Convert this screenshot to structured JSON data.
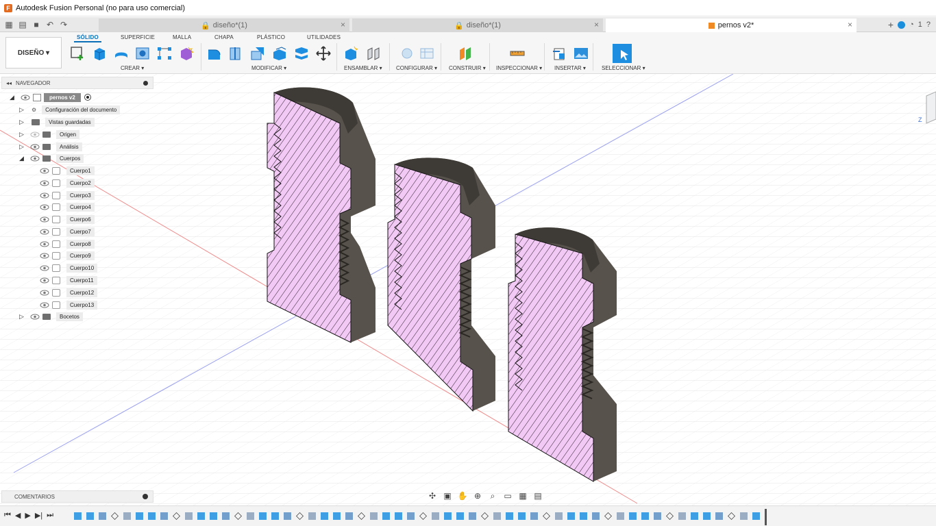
{
  "app": {
    "title": "Autodesk Fusion Personal (no para uso comercial)"
  },
  "tabs": [
    {
      "label": "diseño*(1)",
      "locked": true
    },
    {
      "label": "diseño*(1)",
      "locked": true
    },
    {
      "label": "pernos v2*",
      "active": true
    }
  ],
  "tabbar": {
    "notifications": "1"
  },
  "workspace": {
    "label": "DISEÑO ▾"
  },
  "ribbon_tabs": [
    "SÓLIDO",
    "SUPERFICIE",
    "MALLA",
    "CHAPA",
    "PLÁSTICO",
    "UTILIDADES"
  ],
  "ribbon_groups": [
    "CREAR ▾",
    "MODIFICAR ▾",
    "ENSAMBLAR ▾",
    "CONFIGURAR ▾",
    "CONSTRUIR ▾",
    "INSPECCIONAR ▾",
    "INSERTAR ▾",
    "SELECCIONAR ▾"
  ],
  "browser": {
    "header": "NAVEGADOR",
    "root": "pernos v2",
    "items": [
      "Configuración del documento",
      "Vistas guardadas",
      "Origen",
      "Análisis",
      "Cuerpos"
    ],
    "bodies": [
      "Cuerpo1",
      "Cuerpo2",
      "Cuerpo3",
      "Cuerpo4",
      "Cuerpo6",
      "Cuerpo7",
      "Cuerpo8",
      "Cuerpo9",
      "Cuerpo10",
      "Cuerpo11",
      "Cuerpo12",
      "Cuerpo13"
    ],
    "sketches": "Bocetos"
  },
  "comments": {
    "label": "COMENTARIOS"
  },
  "colors": {
    "accent": "#0b6fb8",
    "section": "#f2c8f4",
    "metal": "#57524c",
    "metal_dark": "#3e3a35"
  }
}
